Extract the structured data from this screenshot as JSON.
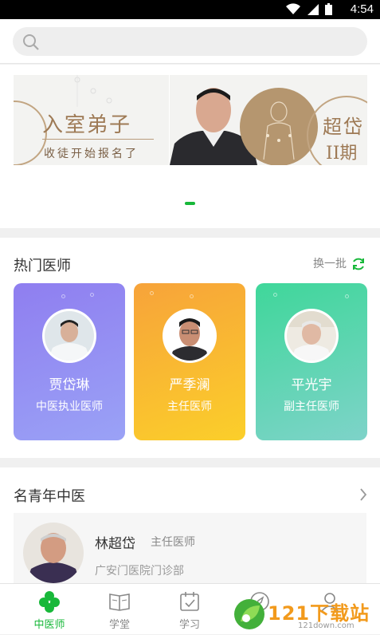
{
  "status_bar": {
    "time": "4:54"
  },
  "search": {
    "placeholder": ""
  },
  "banner": {
    "left_title": "入室弟子",
    "left_subtitle": "收徒开始报名了",
    "right_title": "超岱",
    "right_subtitle": "II期"
  },
  "hot_doctors": {
    "section_title": "热门医师",
    "refresh_label": "换一批",
    "cards": [
      {
        "name": "贾岱琳",
        "title": "中医执业医师",
        "gradient": [
          "#8f7ef0",
          "#9aa2f6"
        ]
      },
      {
        "name": "严季澜",
        "title": "主任医师",
        "gradient": [
          "#f7a33a",
          "#fbcf2a"
        ]
      },
      {
        "name": "平光宇",
        "title": "副主任医师",
        "gradient": [
          "#3fd79a",
          "#7ed3c9"
        ]
      }
    ]
  },
  "young_doctors": {
    "section_title": "名青年中医",
    "items": [
      {
        "name": "林超岱",
        "title": "主任医师",
        "hospital": "广安门医院门诊部"
      }
    ]
  },
  "tabbar": {
    "tabs": [
      {
        "label": "中医师",
        "active": true
      },
      {
        "label": "学堂",
        "active": false
      },
      {
        "label": "学习",
        "active": false
      },
      {
        "label": "",
        "active": false
      },
      {
        "label": "",
        "active": false
      }
    ]
  },
  "watermark": {
    "text": "121下载站",
    "sub": "121down.com"
  },
  "colors": {
    "accent": "#18b83a"
  }
}
